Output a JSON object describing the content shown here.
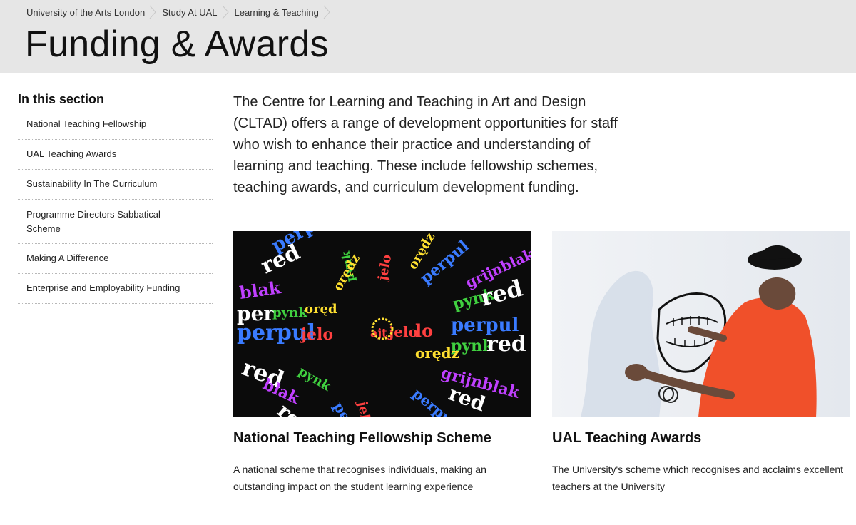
{
  "breadcrumb": {
    "items": [
      "University of the Arts London",
      "Study At UAL",
      "Learning & Teaching"
    ]
  },
  "page_title": "Funding & Awards",
  "sidebar": {
    "heading": "In this section",
    "items": [
      {
        "label": "National Teaching Fellowship"
      },
      {
        "label": "UAL Teaching Awards"
      },
      {
        "label": "Sustainability In The Curriculum"
      },
      {
        "label": "Programme Directors Sabbatical Scheme"
      },
      {
        "label": "Making A Difference"
      },
      {
        "label": "Enterprise and Employability Funding"
      }
    ]
  },
  "intro": "The Centre for Learning and Teaching in Art and Design (CLTAD) offers a range of development opportunities for staff who wish to enhance their practice and understanding of learning and teaching. These include fellowship schemes, teaching awards, and curriculum development funding.",
  "cards": [
    {
      "title": "National Teaching Fellowship Scheme",
      "description": "A national scheme that recognises individuals, making an outstanding impact on the student learning experience"
    },
    {
      "title": "UAL Teaching Awards",
      "description": "The University's scheme which recognises and acclaims excellent teachers at the University"
    }
  ],
  "colors": {
    "header_bg": "#e6e6e6",
    "text": "#1a1a1a",
    "divider": "#b8b8b8"
  }
}
